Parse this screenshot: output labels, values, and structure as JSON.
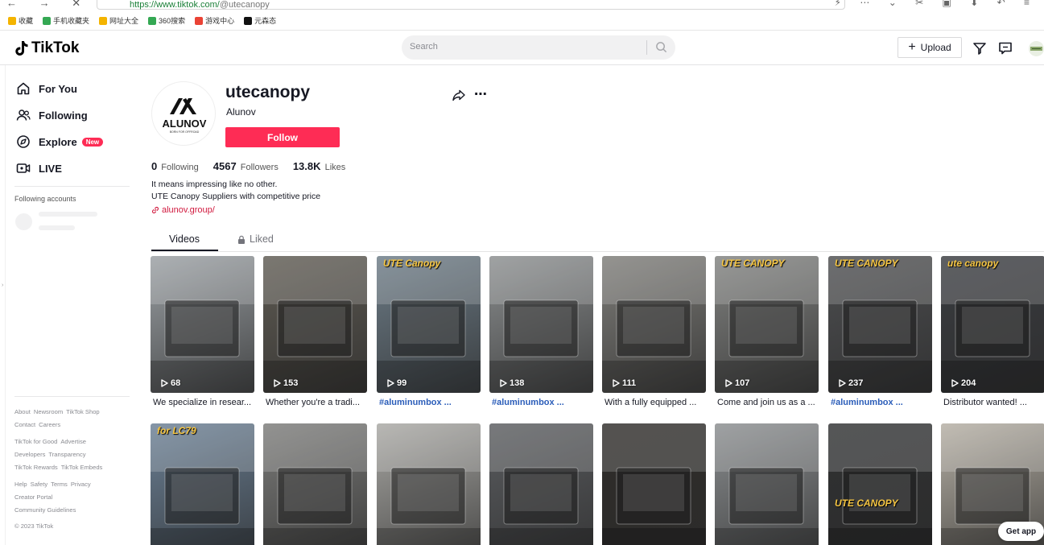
{
  "browser": {
    "url_host": "https://www.tiktok.com/",
    "url_path": "@utecanopy",
    "bookmarks": [
      {
        "label": "收藏",
        "color": "#f4b400"
      },
      {
        "label": "手机收藏夹",
        "color": "#34a853"
      },
      {
        "label": "网址大全",
        "color": "#f4b400"
      },
      {
        "label": "360搜索",
        "color": "#34a853"
      },
      {
        "label": "游戏中心",
        "color": "#ea4335"
      },
      {
        "label": "元森态",
        "color": "#111111"
      }
    ]
  },
  "header": {
    "logo_text": "TikTok",
    "search_placeholder": "Search",
    "upload_label": "Upload"
  },
  "sidebar": {
    "nav": [
      {
        "label": "For You",
        "icon": "home-icon"
      },
      {
        "label": "Following",
        "icon": "users-icon"
      },
      {
        "label": "Explore",
        "icon": "compass-icon",
        "badge": "New"
      },
      {
        "label": "LIVE",
        "icon": "live-icon"
      }
    ],
    "following_accounts_title": "Following accounts",
    "footer": [
      [
        "About",
        "Newsroom",
        "TikTok Shop"
      ],
      [
        "Contact",
        "Careers"
      ],
      [
        "TikTok for Good",
        "Advertise"
      ],
      [
        "Developers",
        "Transparency"
      ],
      [
        "TikTok Rewards",
        "TikTok Embeds"
      ],
      [
        "Help",
        "Safety",
        "Terms",
        "Privacy"
      ],
      [
        "Creator Portal"
      ],
      [
        "Community Guidelines"
      ],
      [
        "© 2023 TikTok"
      ]
    ]
  },
  "profile": {
    "username": "utecanopy",
    "nickname": "Alunov",
    "avatar_text": "ALUNOV",
    "avatar_subtext": "BORN FOR OFFROAD",
    "follow_label": "Follow",
    "stats": [
      {
        "value": "0",
        "label": "Following"
      },
      {
        "value": "4567",
        "label": "Followers"
      },
      {
        "value": "13.8K",
        "label": "Likes"
      }
    ],
    "bio_line1": "It means impressing like no other.",
    "bio_line2": "UTE Canopy Suppliers with competitive price",
    "link": "alunov.group/"
  },
  "tabs": {
    "videos": "Videos",
    "liked": "Liked"
  },
  "videos_row1": [
    {
      "views": "68",
      "caption": "We specialize in resear...",
      "tag": false,
      "bg": "#9a9fa3"
    },
    {
      "views": "153",
      "caption": "Whether you're a tradi...",
      "tag": false,
      "bg": "#5e5a52"
    },
    {
      "views": "99",
      "caption": "#aluminumbox ...",
      "tag": true,
      "bg": "#6c7b86",
      "overlay": "UTE Canopy"
    },
    {
      "views": "138",
      "caption": "#aluminumbox ...",
      "tag": true,
      "bg": "#8b8e8f"
    },
    {
      "views": "111",
      "caption": "With a fully equipped ...",
      "tag": false,
      "bg": "#7d7c78"
    },
    {
      "views": "107",
      "caption": "Come and join us as a ...",
      "tag": false,
      "bg": "#80817f",
      "overlay": "UTE CANOPY"
    },
    {
      "views": "237",
      "caption": "#aluminumbox ...",
      "tag": true,
      "bg": "#4d4e50",
      "overlay": "UTE CANOPY"
    },
    {
      "views": "204",
      "caption": "Distributor wanted! ...",
      "tag": false,
      "bg": "#3a3c40",
      "overlay": "ute canopy"
    }
  ],
  "videos_row2": [
    {
      "bg": "#6a7f94",
      "overlay": "for LC79"
    },
    {
      "bg": "#7b7b79"
    },
    {
      "bg": "#a9a8a4"
    },
    {
      "bg": "#5a5c5f"
    },
    {
      "bg": "#2f2c2a"
    },
    {
      "bg": "#8a8d8f"
    },
    {
      "bg": "#303132",
      "overlay": "UTE CANOPY"
    },
    {
      "bg": "#b4aea3"
    }
  ],
  "get_app": "Get app"
}
